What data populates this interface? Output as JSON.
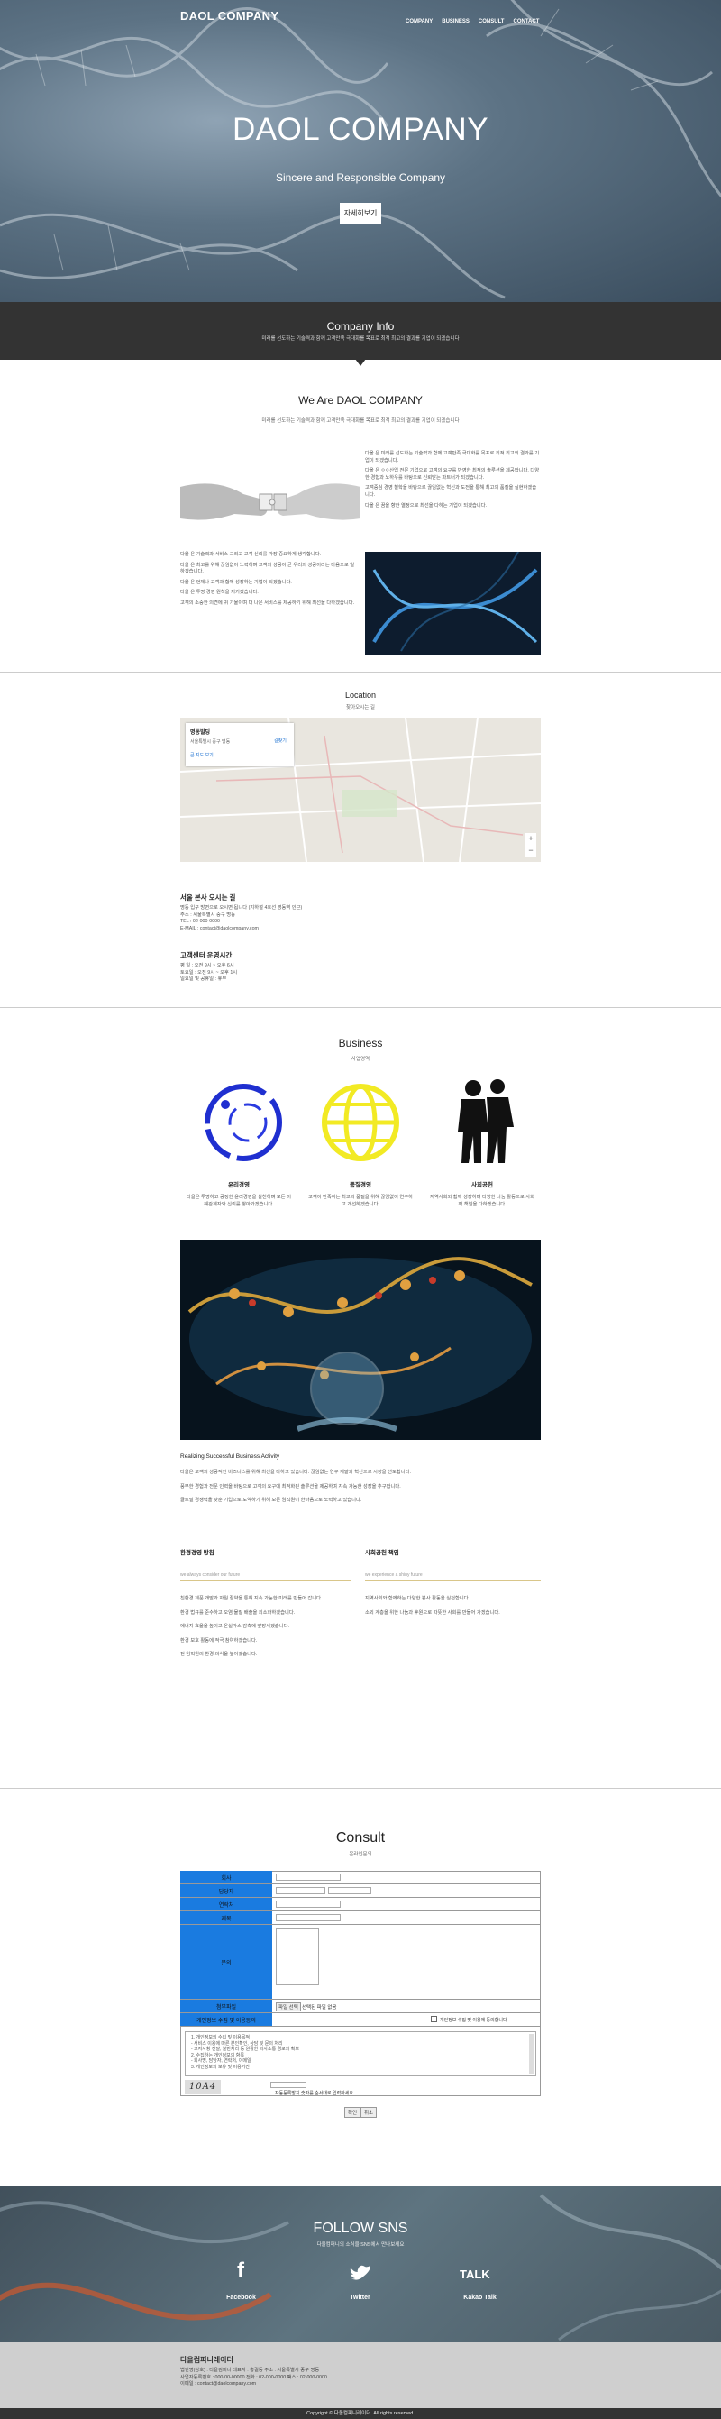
{
  "nav": {
    "logo": "DAOL COMPANY",
    "items": [
      "COMPANY",
      "BUSINESS",
      "CONSULT",
      "CONTACT"
    ]
  },
  "hero": {
    "title": "DAOL COMPANY",
    "subtitle": "Sincere and Responsible Company",
    "button": "자세히보기"
  },
  "company_info": {
    "title": "Company Info",
    "subtitle": "미래를 선도하는 기술력과 함께 고객만족 극대화를 목표로 최적 최고의 결과를 기업이 되겠습니다"
  },
  "about": {
    "title": "We Are DAOL COMPANY",
    "subtitle": "미래를 선도하는 기술력과 함께 고객만족 극대화를 목표로 최적 최고의 결과를 기업이 되겠습니다",
    "right_text": [
      "다올 은 미래를 선도하는 기술력과 함께 고객만족 극대화를 목표로 최적 최고의 결과를 기업이 되겠습니다.",
      "다올 은 ㅇㅇ산업 전문 기업으로 고객의 요구를 반영한 최적의 솔루션을 제공합니다. 다양한 경험과 노하우를 바탕으로 신뢰받는 파트너가 되겠습니다.",
      "고객중심 경영 철학을 바탕으로 끊임없는 혁신과 도전을 통해 최고의 품질을 실현하겠습니다.",
      "다올 은 꿈을 향한 열정으로 최선을 다하는 기업이 되겠습니다."
    ],
    "left_text": [
      "다올 은 기술력과 서비스 그리고 고객 신뢰를 가장 중요하게 생각합니다.",
      "다올 은 최고를 위해 끊임없이 노력하며 고객의 성공이 곧 우리의 성공이라는 마음으로 일하겠습니다.",
      "다올 은 언제나 고객과 함께 성장하는 기업이 되겠습니다.",
      "다올 은 투명 경영 원칙을 지키겠습니다.",
      "고객의 소중한 의견에 귀 기울이며 더 나은 서비스를 제공하기 위해 최선을 다하겠습니다."
    ]
  },
  "location": {
    "title": "Location",
    "subtitle": "찾아오시는 길",
    "map_card": {
      "name": "명동빌딩",
      "addr": "서울특별시 중구 명동",
      "link": "큰 지도 보기",
      "route": "길찾기"
    },
    "heading": "서울 본사 오시는 길",
    "lines": [
      "명동 입구 방면으로 오시면 됩니다 (지하철 4호선 명동역 인근)",
      "주소 : 서울특별시 중구 명동",
      "TEL : 02-000-0000",
      "E-MAIL : contact@daolcompany.com"
    ],
    "hours_heading": "고객센터 운영시간",
    "hours": [
      "평 일 : 오전 9시 ~ 오후 6시",
      "토요일 : 오전 9시 ~ 오후 1시",
      "일요일 및 공휴일 : 휴무"
    ]
  },
  "business": {
    "title": "Business",
    "subtitle": "사업영역",
    "items": [
      {
        "label": "윤리경영",
        "text": "다올은 투명하고 공정한 윤리경영을 실천하며 모든 이해관계자와 신뢰를 쌓아가겠습니다."
      },
      {
        "label": "품질경영",
        "text": "고객이 만족하는 최고의 품질을 위해 끊임없이 연구하고 개선하겠습니다."
      },
      {
        "label": "사회공헌",
        "text": "지역사회와 함께 성장하며 다양한 나눔 활동으로 사회적 책임을 다하겠습니다."
      }
    ],
    "heading": "Realizing Successful Business Activity",
    "paras": [
      "다올은 고객의 성공적인 비즈니스를 위해 최선을 다하고 있습니다. 끊임없는 연구 개발과 혁신으로 시장을 선도합니다.",
      "풍부한 경험과 전문 인력을 바탕으로 고객의 요구에 최적화된 솔루션을 제공하며 지속 가능한 성장을 추구합니다.",
      "글로벌 경쟁력을 갖춘 기업으로 도약하기 위해 모든 임직원이 한마음으로 노력하고 있습니다."
    ],
    "col1": {
      "title": "환경경영 방침",
      "sub": "we always consider our future",
      "items": [
        "친환경 제품 개발과 자원 절약을 통해 지속 가능한 미래를 만들어 갑니다.",
        "환경 법규를 준수하고 오염 물질 배출을 최소화하겠습니다.",
        "에너지 효율을 높이고 온실가스 감축에 앞장서겠습니다.",
        "환경 보호 활동에 적극 참여하겠습니다.",
        "전 임직원의 환경 의식을 높이겠습니다."
      ]
    },
    "col2": {
      "title": "사회공헌 책임",
      "sub": "we experience a shiny future",
      "items": [
        "지역사회와 함께하는 다양한 봉사 활동을 실천합니다.",
        "소외 계층을 위한 나눔과 후원으로 따뜻한 사회를 만들어 가겠습니다."
      ]
    }
  },
  "consult": {
    "title": "Consult",
    "subtitle": "온라인문의",
    "fields": [
      "회사",
      "담당자",
      "연락처",
      "제목",
      "문의",
      "첨부파일",
      "개인정보 수집 및 이용동의"
    ],
    "file_btn": "파일 선택",
    "file_text": "선택된 파일 없음",
    "agree": "개인정보 수집 및 이용에 동의합니다",
    "privacy": [
      "1. 개인정보의 수집 및 이용목적",
      "- 서비스 이용에 따른 본인확인, 상담 및 문의 처리",
      "- 고지사항 전달, 불만처리 등 원활한 의사소통 경로의 확보",
      "2. 수집하는 개인정보의 항목",
      "- 회사명, 담당자, 연락처, 이메일",
      "3. 개인정보의 보유 및 이용기간"
    ],
    "captcha": "10A4",
    "captcha_note": "자동등록방지 숫자를 순서대로 입력하세요.",
    "submit": "확인",
    "cancel": "취소"
  },
  "sns": {
    "title": "FOLLOW SNS",
    "subtitle": "다올컴퍼니의 소식을 SNS에서 만나보세요",
    "items": [
      "Facebook",
      "Twitter",
      "Kakao Talk"
    ],
    "talk_icon": "TALK"
  },
  "footer": {
    "company": "다올컴퍼니레이더",
    "lines": [
      "법인명(상호) : 다올컴퍼니  대표자 : 홍길동  주소 : 서울특별시 중구 명동",
      "사업자등록번호 : 000-00-00000  전화 : 02-000-0000  팩스 : 02-000-0000",
      "이메일 : contact@daolcompany.com"
    ],
    "copyright": "Copyright © 다올컴퍼니레이더. All rights reserved."
  }
}
